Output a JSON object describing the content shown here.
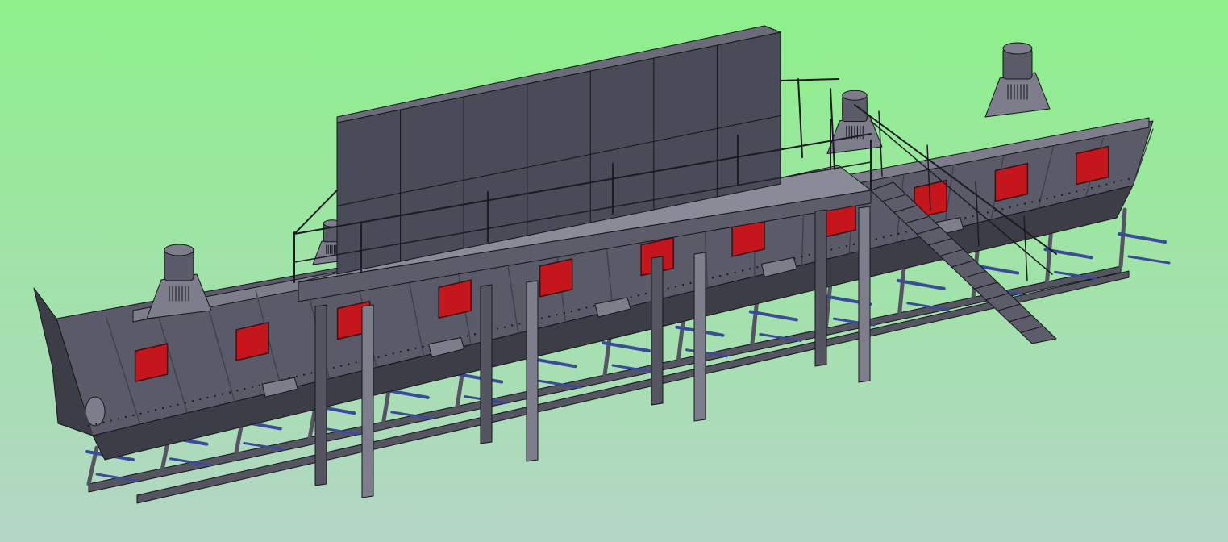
{
  "viewport": {
    "background_top": "#8df08a",
    "background_bottom": "#b4d6c6"
  },
  "palette": {
    "machine_body": "#5a5a68",
    "machine_dark": "#3d3d48",
    "machine_light": "#7d7d8c",
    "cabinet_front": "#4a4b58",
    "cabinet_top": "#6b6c7a",
    "cabinet_side": "#3a3b46",
    "platform_deck": "#8a8a98",
    "platform_edge": "#5c5c6a",
    "frame_steel": "#555562",
    "frame_blue": "#3c4a9a",
    "inspection_door": "#c4161c",
    "door_border": "#3a1012",
    "outline": "#15151a",
    "railing": "#1b1b22"
  },
  "objects": {
    "machine": "vibrating-fluid-bed-conveyor",
    "cabinet": "electrical-cabinet-block",
    "platform": "maintenance-platform",
    "stair": "access-stair",
    "motors": "vibration-motor-icon",
    "door": "inspection-door"
  }
}
